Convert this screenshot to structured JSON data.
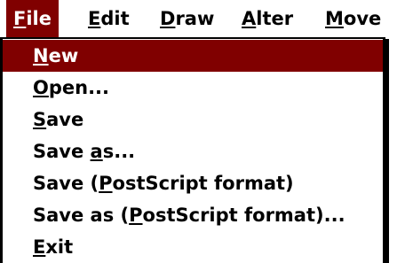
{
  "colors": {
    "highlight": "#800000",
    "highlight_text": "#ffffff",
    "text": "#000000",
    "background": "#ffffff"
  },
  "menubar": {
    "items": [
      {
        "prefix": "",
        "key": "F",
        "rest": "ile"
      },
      {
        "prefix": "",
        "key": "E",
        "rest": "dit"
      },
      {
        "prefix": "",
        "key": "D",
        "rest": "raw"
      },
      {
        "prefix": "",
        "key": "A",
        "rest": "lter"
      },
      {
        "prefix": "",
        "key": "M",
        "rest": "ove"
      }
    ]
  },
  "file_menu": {
    "items": [
      {
        "prefix": "",
        "key": "N",
        "rest": "ew"
      },
      {
        "prefix": "",
        "key": "O",
        "rest": "pen..."
      },
      {
        "prefix": "",
        "key": "S",
        "rest": "ave"
      },
      {
        "prefix": "Save ",
        "key": "a",
        "rest": "s..."
      },
      {
        "prefix": "Save (",
        "key": "P",
        "rest": "ostScript format)"
      },
      {
        "prefix": "Save as (",
        "key": "P",
        "rest": "ostScript format)..."
      },
      {
        "prefix": "",
        "key": "E",
        "rest": "xit"
      }
    ]
  }
}
